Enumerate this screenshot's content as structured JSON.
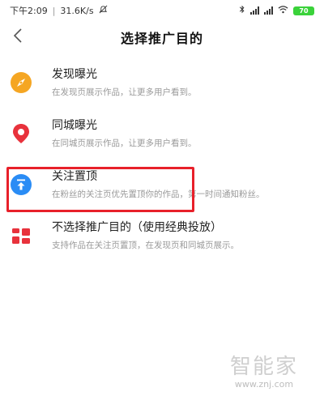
{
  "status_bar": {
    "time": "下午2:09",
    "speed": "31.6K/s",
    "battery": "70"
  },
  "header": {
    "title": "选择推广目的"
  },
  "items": [
    {
      "title": "发现曝光",
      "subtitle": "在发现页展示作品，让更多用户看到。",
      "icon": "compass-icon",
      "color": "#f5a623"
    },
    {
      "title": "同城曝光",
      "subtitle": "在同城页展示作品，让更多用户看到。",
      "icon": "location-pin-icon",
      "color": "#e8323c"
    },
    {
      "title": "关注置顶",
      "subtitle": "在粉丝的关注页优先置顶你的作品，第一时间通知粉丝。",
      "icon": "pin-to-top-icon",
      "color": "#2a8cf5"
    },
    {
      "title": "不选择推广目的（使用经典投放）",
      "subtitle": "支持作品在关注页置顶，在发现页和同城页展示。",
      "icon": "grid-icon",
      "color": "#e8323c"
    }
  ],
  "watermark": {
    "main": "智能家",
    "url": "www.znj.com"
  }
}
